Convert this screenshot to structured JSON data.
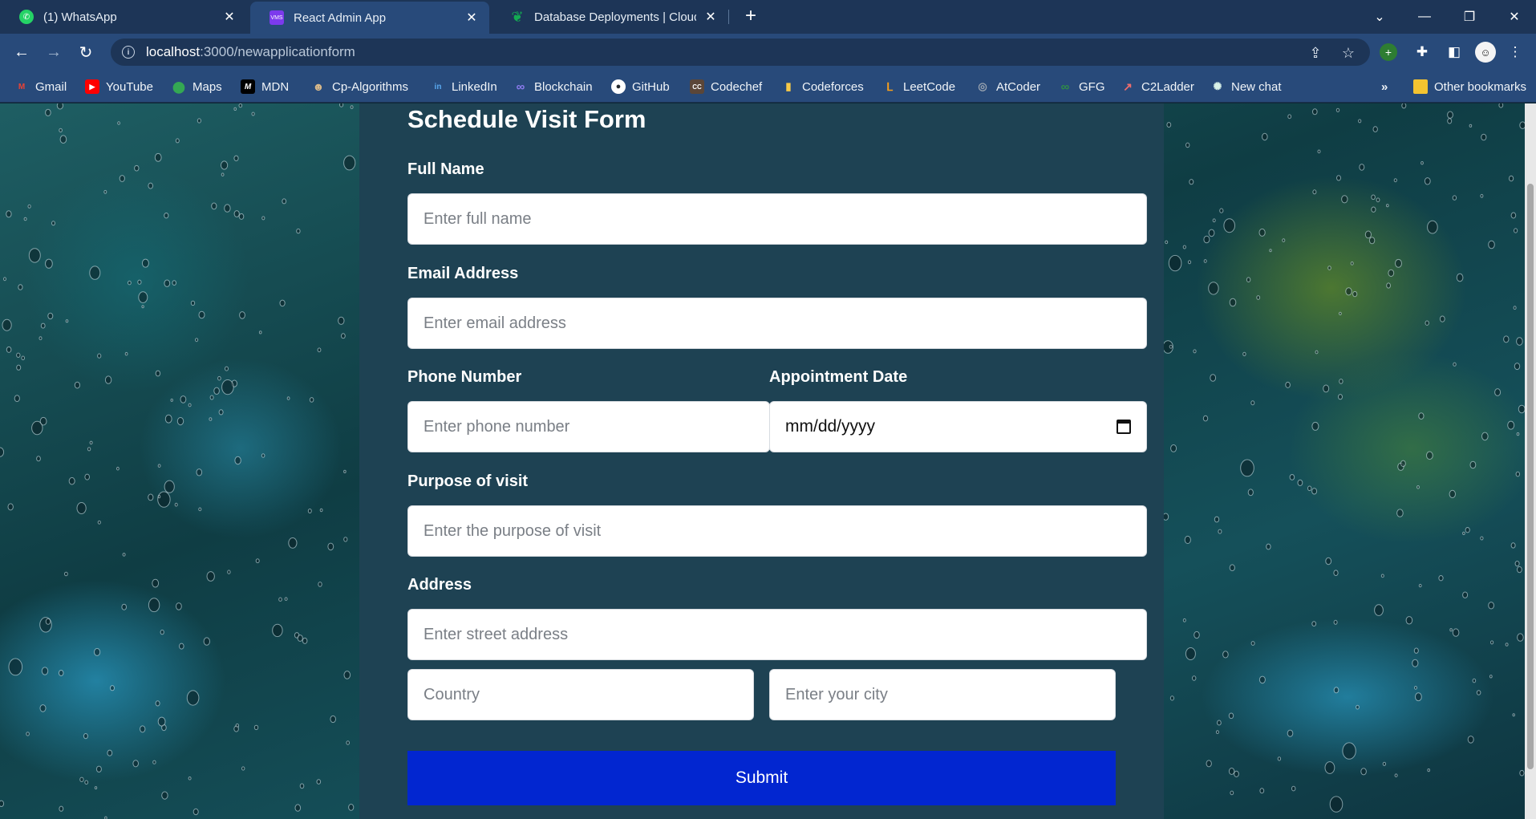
{
  "browser": {
    "tabs": [
      {
        "title": "(1) WhatsApp",
        "active": false,
        "favicon": "whatsapp-icon",
        "color": "#25d366"
      },
      {
        "title": "React Admin App",
        "active": true,
        "favicon": "vms-icon",
        "color": "#7c3aed",
        "favicon_text": "VMS"
      },
      {
        "title": "Database Deployments | Cloud: M",
        "active": false,
        "favicon": "mongodb-leaf-icon",
        "color": "#13aa52"
      }
    ],
    "url_host": "localhost",
    "url_path": ":3000/newapplicationform",
    "bookmarks": [
      {
        "label": "Gmail",
        "icon": "gmail-icon",
        "color": "#ea4335",
        "glyph": "M"
      },
      {
        "label": "YouTube",
        "icon": "youtube-icon",
        "color": "#ff0000",
        "glyph": "▶"
      },
      {
        "label": "Maps",
        "icon": "maps-pin-icon",
        "color": "#34a853",
        "glyph": "●"
      },
      {
        "label": "MDN",
        "icon": "mdn-icon",
        "color": "#000000",
        "glyph": "M"
      },
      {
        "label": "Cp-Algorithms",
        "icon": "cp-algorithms-icon",
        "color": "#8a6a3a",
        "glyph": "☻"
      },
      {
        "label": "LinkedIn",
        "icon": "linkedin-icon",
        "color": "#0a66c2",
        "glyph": "in"
      },
      {
        "label": "Blockchain",
        "icon": "blockchain-icon",
        "color": "#6b5bd6",
        "glyph": "∞"
      },
      {
        "label": "GitHub",
        "icon": "github-icon",
        "color": "#24292e",
        "glyph": "●"
      },
      {
        "label": "Codechef",
        "icon": "codechef-icon",
        "color": "#5b4638",
        "glyph": "CC"
      },
      {
        "label": "Codeforces",
        "icon": "codeforces-icon",
        "color": "#1f8acb",
        "glyph": "▮"
      },
      {
        "label": "LeetCode",
        "icon": "leetcode-icon",
        "color": "#f89f1b",
        "glyph": "ᒪ"
      },
      {
        "label": "AtCoder",
        "icon": "atcoder-icon",
        "color": "#555555",
        "glyph": "◎"
      },
      {
        "label": "GFG",
        "icon": "gfg-icon",
        "color": "#2f8d46",
        "glyph": "∞"
      },
      {
        "label": "C2Ladder",
        "icon": "c2ladder-icon",
        "color": "#d04a4a",
        "glyph": "↗"
      },
      {
        "label": "New chat",
        "icon": "chatgpt-icon",
        "color": "#10a37f",
        "glyph": "✺"
      }
    ],
    "other_bookmarks": "Other bookmarks"
  },
  "form": {
    "title": "Schedule Visit Form",
    "full_name": {
      "label": "Full Name",
      "placeholder": "Enter full name"
    },
    "email": {
      "label": "Email Address",
      "placeholder": "Enter email address"
    },
    "phone": {
      "label": "Phone Number",
      "placeholder": "Enter phone number"
    },
    "appointment": {
      "label": "Appointment Date",
      "value": "mm/dd/yyyy"
    },
    "purpose": {
      "label": "Purpose of visit",
      "placeholder": "Enter the purpose of visit"
    },
    "address": {
      "label": "Address",
      "placeholder": "Enter street address"
    },
    "country": {
      "placeholder": "Country"
    },
    "city": {
      "placeholder": "Enter your city"
    },
    "submit_label": "Submit"
  }
}
